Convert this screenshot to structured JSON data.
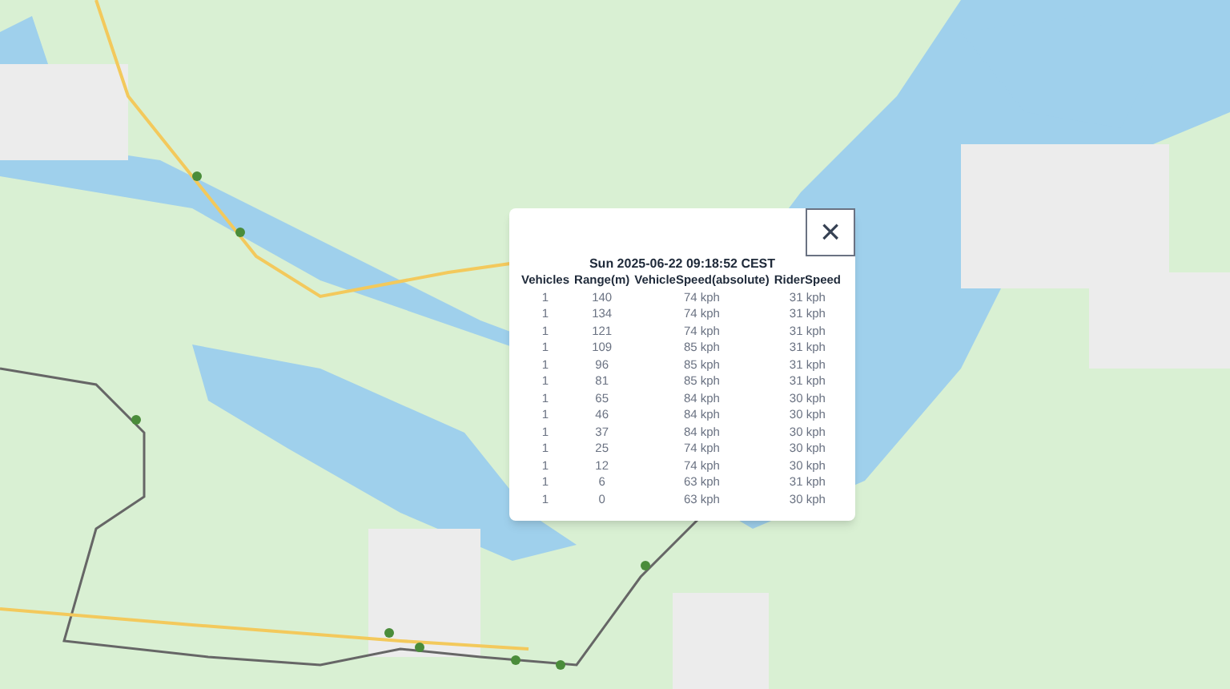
{
  "popup": {
    "close": "×",
    "title": "Sun 2025-06-22 09:18:52 CEST",
    "columns": [
      "Vehicles",
      "Range(m)",
      "VehicleSpeed(absolute)",
      "RiderSpeed"
    ],
    "rows": [
      [
        "1",
        "140",
        "74 kph",
        "31 kph"
      ],
      [
        "1",
        "134",
        "74 kph",
        "31 kph"
      ],
      [
        "1",
        "121",
        "74 kph",
        "31 kph"
      ],
      [
        "1",
        "109",
        "85 kph",
        "31 kph"
      ],
      [
        "1",
        "96",
        "85 kph",
        "31 kph"
      ],
      [
        "1",
        "81",
        "85 kph",
        "31 kph"
      ],
      [
        "1",
        "65",
        "84 kph",
        "30 kph"
      ],
      [
        "1",
        "46",
        "84 kph",
        "30 kph"
      ],
      [
        "1",
        "37",
        "84 kph",
        "30 kph"
      ],
      [
        "1",
        "25",
        "74 kph",
        "30 kph"
      ],
      [
        "1",
        "12",
        "74 kph",
        "30 kph"
      ],
      [
        "1",
        "6",
        "63 kph",
        "31 kph"
      ],
      [
        "1",
        "0",
        "63 kph",
        "30 kph"
      ]
    ]
  }
}
